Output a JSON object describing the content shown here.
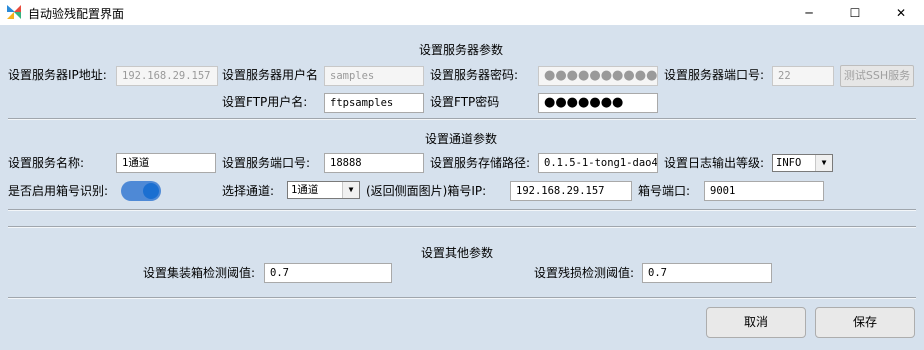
{
  "window": {
    "title": "自动验残配置界面",
    "minimize": "─",
    "maximize": "☐",
    "close": "✕",
    "icon": "app-logo-icon"
  },
  "server": {
    "section_title": "设置服务器参数",
    "ip_label": "设置服务器IP地址:",
    "ip_value": "192.168.29.157",
    "user_label": "设置服务器用户名",
    "user_value": "samples",
    "password_label": "设置服务器密码:",
    "password_value": "●●●●●●●●●●",
    "port_label": "设置服务器端口号:",
    "port_value": "22",
    "test_ssh_button": "测试SSH服务",
    "ftp_user_label": "设置FTP用户名:",
    "ftp_user_value": "ftpsamples",
    "ftp_password_label": "设置FTP密码",
    "ftp_password_value": "●●●●●●●"
  },
  "channel": {
    "section_title": "设置通道参数",
    "service_name_label": "设置服务名称:",
    "service_name_value": "1通道",
    "service_port_label": "设置服务端口号:",
    "service_port_value": "18888",
    "storage_path_label": "设置服务存储路径:",
    "storage_path_value": "0.1.5-1-tong1-dao4",
    "log_level_label": "设置日志输出等级:",
    "log_level_value": "INFO",
    "box_recognition_label": "是否启用箱号识别:",
    "box_recognition_enabled": true,
    "select_channel_label": "选择通道:",
    "select_channel_value": "1通道",
    "return_side_label": "(返回侧面图片)箱号IP:",
    "box_ip_value": "192.168.29.157",
    "box_port_label": "箱号端口:",
    "box_port_value": "9001"
  },
  "other": {
    "section_title": "设置其他参数",
    "container_threshold_label": "设置集装箱检测阈值:",
    "container_threshold_value": "0.7",
    "damage_threshold_label": "设置残损检测阈值:",
    "damage_threshold_value": "0.7"
  },
  "footer": {
    "cancel_label": "取消",
    "save_label": "保存"
  },
  "colors": {
    "background": "#d6e1ed",
    "toggle_track": "#4e89d6",
    "toggle_knob": "#1b6fd1"
  }
}
